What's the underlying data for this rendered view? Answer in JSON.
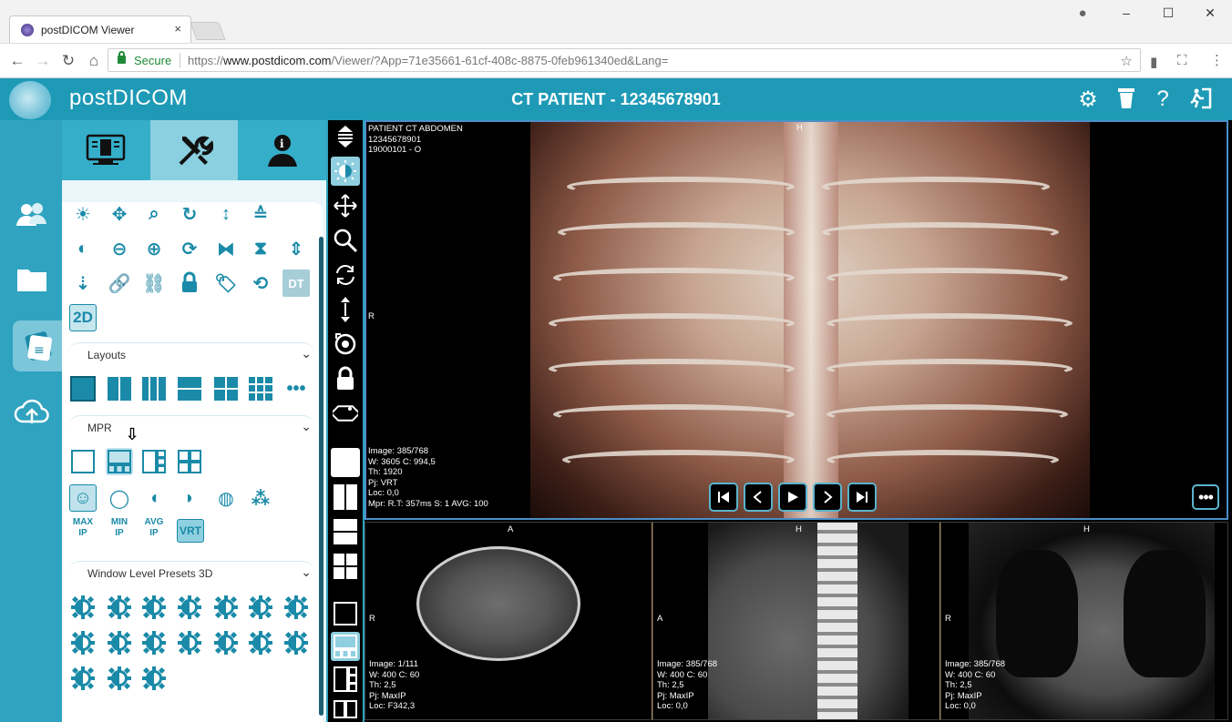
{
  "browser": {
    "tab_title": "postDICOM Viewer",
    "tab_close": "×",
    "secure_label": "Secure",
    "url_prefix": "https://",
    "url_host": "www.postdicom.com",
    "url_path": "/Viewer/?App=71e35661-61cf-408c-8875-0feb961340ed&Lang=",
    "window_controls": [
      "–",
      "☐",
      "✕"
    ]
  },
  "app": {
    "logo": "postDICOM",
    "title": "CT PATIENT - 12345678901",
    "header_icons": [
      "settings-icon",
      "trash-cup-icon",
      "help-icon",
      "exit-icon"
    ],
    "accent": "#1e9ab6"
  },
  "panel": {
    "tabs": [
      "viewer-tab",
      "tools-tab",
      "info-tab"
    ],
    "sections": {
      "layouts": "Layouts",
      "mpr": "MPR",
      "wl_presets": "Window Level Presets 3D"
    },
    "tool_2d": "2D",
    "tool_dt": "DT",
    "mpr_text_buttons": [
      {
        "line1": "MAX",
        "line2": "IP"
      },
      {
        "line1": "MIN",
        "line2": "IP"
      },
      {
        "line1": "AVG",
        "line2": "IP"
      }
    ],
    "vrt": "VRT"
  },
  "viewer": {
    "main": {
      "top_left": "PATIENT CT ABDOMEN\n12345678901\n19000101 - O",
      "bottom_left": "Image: 385/768\nW: 3605 C: 994,5\nTh: 1920\nPj: VRT\nLoc: 0,0\nMpr: R.T: 357ms S: 1 AVG: 100",
      "orient_top": "H",
      "orient_left": "R"
    },
    "axial": {
      "orient_top": "A",
      "orient_left": "R",
      "info": "Image: 1/111\nW: 400 C: 60\nTh: 2,5\nPj: MaxIP\nLoc: F342,3"
    },
    "sagittal": {
      "orient_top": "H",
      "orient_left": "A",
      "info": "Image: 385/768\nW: 400 C: 60\nTh: 2,5\nPj: MaxIP\nLoc: 0,0"
    },
    "coronal": {
      "orient_top": "H",
      "orient_left": "R",
      "info": "Image: 385/768\nW: 400 C: 60\nTh: 2,5\nPj: MaxIP\nLoc: 0,0"
    }
  }
}
